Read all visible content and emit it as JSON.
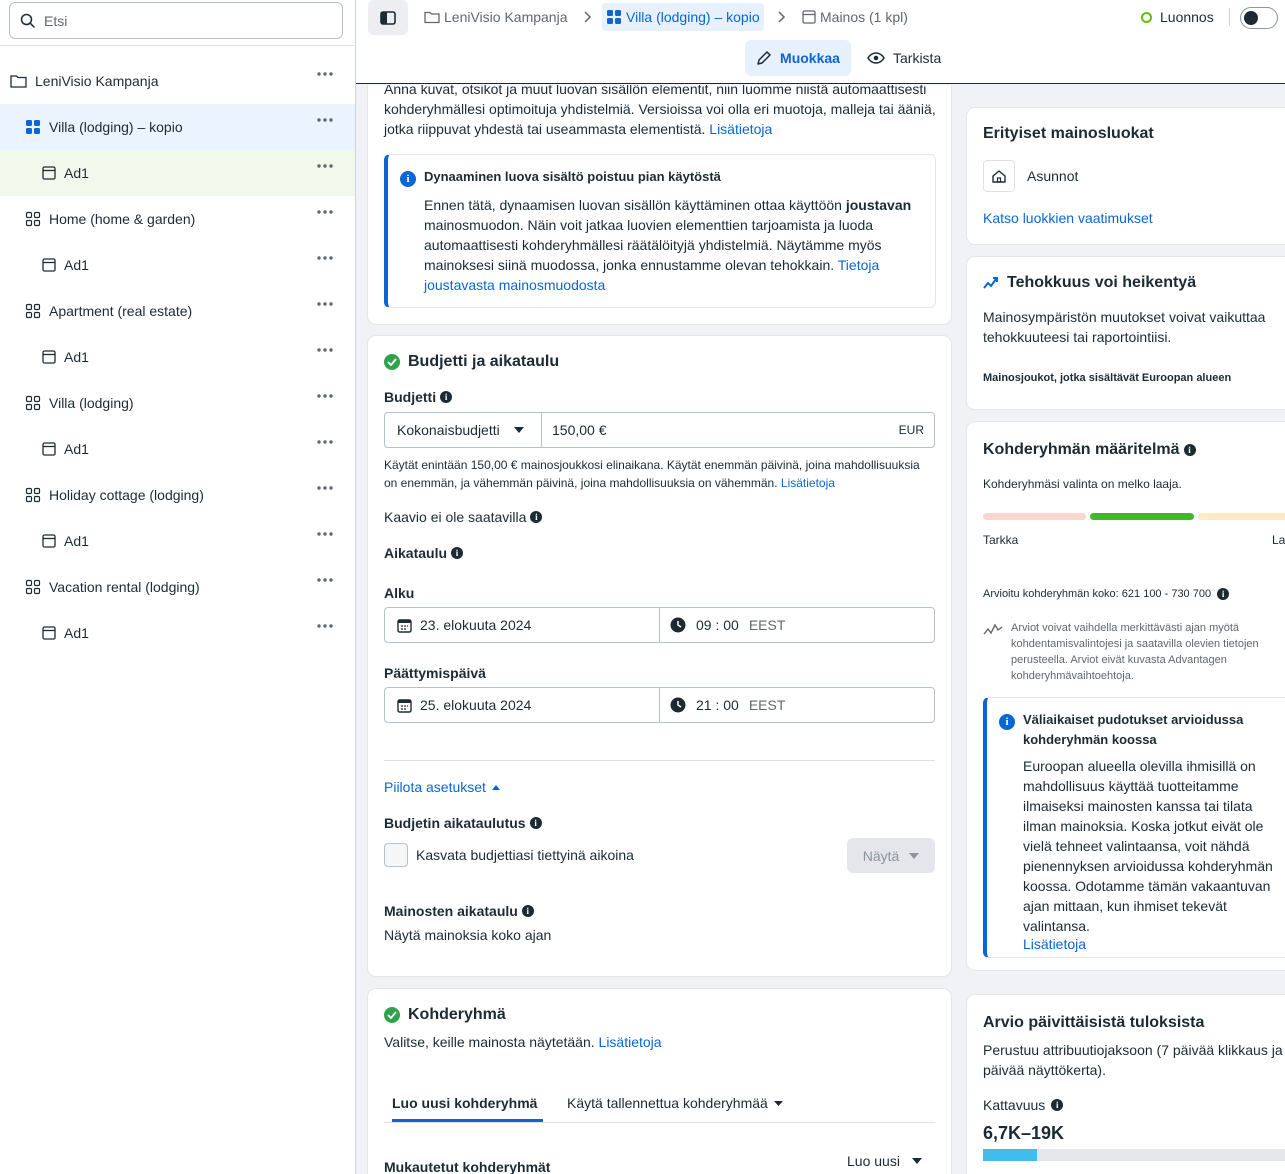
{
  "sidebar": {
    "search_placeholder": "Etsi",
    "items": [
      {
        "label": "LeniVisio Kampanja"
      },
      {
        "label": "Villa (lodging) – kopio"
      },
      {
        "label": "Ad1"
      },
      {
        "label": "Home (home & garden)"
      },
      {
        "label": "Ad1"
      },
      {
        "label": "Apartment (real estate)"
      },
      {
        "label": "Ad1"
      },
      {
        "label": "Villa (lodging)"
      },
      {
        "label": "Ad1"
      },
      {
        "label": "Holiday cottage (lodging)"
      },
      {
        "label": "Ad1"
      },
      {
        "label": "Vacation rental (lodging)"
      },
      {
        "label": "Ad1"
      }
    ]
  },
  "header": {
    "breadcrumbs": [
      "LeniVisio Kampanja",
      "Villa (lodging) – kopio",
      "Mainos (1 kpl)"
    ],
    "status": "Luonnos",
    "tab_edit": "Muokkaa",
    "tab_review": "Tarkista"
  },
  "creative": {
    "intro": "Anna kuvat, otsikot ja muut luovan sisällön elementit, niin luomme niistä automaattisesti kohderyhmällesi optimoituja yhdistelmiä. Versioissa voi olla eri muotoja, malleja tai ääniä, jotka riippuvat yhdestä tai useammasta elementistä.",
    "intro_link": "Lisätietoja",
    "callout_title": "Dynaaminen luova sisältö poistuu pian käytöstä",
    "callout_text_a": "Ennen tätä, dynaamisen luovan sisällön käyttäminen ottaa käyttöön ",
    "callout_bold": "joustavan",
    "callout_text_b": " mainosmuodon. Näin voit jatkaa luovien elementtien tarjoamista ja luoda automaattisesti kohderyhmällesi räätälöityjä yhdistelmiä. Näytämme myös mainoksesi siinä muodossa, jonka ennustamme olevan tehokkain.",
    "callout_link": "Tietoja joustavasta mainosmuodosta"
  },
  "budget": {
    "title": "Budjetti ja aikataulu",
    "budget_label": "Budjetti",
    "budget_type": "Kokonaisbudjetti",
    "amount": "150,00 €",
    "currency": "EUR",
    "note": "Käytät enintään 150,00 € mainosjoukkosi elinaikana. Käytät enemmän päivinä, joina mahdollisuuksia on enemmän, ja vähemmän päivinä, joina mahdollisuuksia on vähemmän.",
    "note_link": "Lisätietoja",
    "chart_unavailable": "Kaavio ei ole saatavilla",
    "schedule_label": "Aikataulu",
    "start_label": "Alku",
    "start_date": "23. elokuuta 2024",
    "start_time": "09 : 00",
    "start_tz": "EEST",
    "end_label": "Päättymispäivä",
    "end_date": "25. elokuuta 2024",
    "end_time": "21 : 00",
    "end_tz": "EEST",
    "hide_settings": "Piilota asetukset",
    "budget_scheduling": "Budjetin aikataulutus",
    "increase_label": "Kasvata budjettiasi tiettyinä aikoina",
    "show_button": "Näytä",
    "ad_schedule_label": "Mainosten aikataulu",
    "ad_schedule_value": "Näytä mainoksia koko ajan"
  },
  "audience": {
    "title": "Kohderyhmä",
    "desc": "Valitse, keille mainosta näytetään.",
    "desc_link": "Lisätietoja",
    "tab_new": "Luo uusi kohderyhmä",
    "tab_saved": "Käytä tallennettua kohderyhmää",
    "custom_label": "Mukautetut kohderyhmät",
    "create_new": "Luo uusi"
  },
  "right": {
    "special_title": "Erityiset mainosluokat",
    "special_item": "Asunnot",
    "special_link": "Katso luokkien vaatimukset",
    "perf_title": "Tehokkuus voi heikentyä",
    "perf_text": "Mainosympäristön muutokset voivat vaikuttaa tehokkuuteesi tai raportointiisi.",
    "perf_note": "Mainosjoukot, jotka sisältävät Euroopan alueen",
    "def_title": "Kohderyhmän määritelmä",
    "def_text": "Kohderyhmäsi valinta on melko laaja.",
    "meter_left": "Tarkka",
    "meter_right": "La",
    "meter_level": "middle",
    "size_text": "Arvioitu kohderyhmän koko: 621 100 - 730 700",
    "estimate_note": "Arviot voivat vaihdella merkittävästi ajan myötä kohdentamisvalintojesi ja saatavilla olevien tietojen perusteella. Arviot eivät kuvasta Advantagen kohderyhmävaihtoehtoja.",
    "drop_title": "Väliaikaiset pudotukset arvioidussa kohderyhmän koossa",
    "drop_text": "Euroopan alueella olevilla ihmisillä on mahdollisuus käyttää tuotteitamme ilmaiseksi mainosten kanssa tai tilata ilman mainoksia. Koska jotkut eivät ole vielä tehneet valintaansa, voit nähdä pienennyksen arvioidussa kohderyhmän koossa. Odotamme tämän vakaantuvan ajan mittaan, kun ihmiset tekevät valintansa.",
    "drop_link": "Lisätietoja",
    "daily_title": "Arvio päivittäisistä tuloksista",
    "daily_text": "Perustuu attribuutiojaksoon (7 päivää klikkaus ja päivää näyttökerta).",
    "reach_label": "Kattavuus",
    "reach_value": "6,7K–19K",
    "reach_fill": 0.17
  },
  "colors": {
    "accent": "#0a66d2",
    "success": "#31a24c",
    "draft": "#63be09"
  }
}
